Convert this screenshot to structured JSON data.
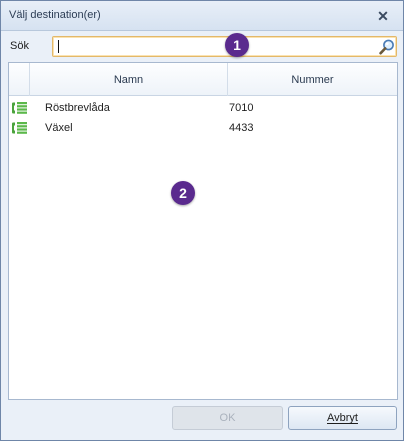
{
  "window": {
    "title": "Välj destination(er)",
    "close_glyph": "✕"
  },
  "search": {
    "label": "Sök",
    "value": "",
    "placeholder": ""
  },
  "grid": {
    "columns": [
      "Namn",
      "Nummer"
    ],
    "rows": [
      {
        "icon": "phone-list-icon",
        "name": "Röstbrevlåda",
        "number": "7010"
      },
      {
        "icon": "phone-list-icon",
        "name": "Växel",
        "number": "4433"
      }
    ]
  },
  "buttons": {
    "ok_label": "OK",
    "cancel_label": "Avbryt"
  },
  "callouts": [
    "1",
    "2"
  ],
  "colors": {
    "callout": "#5a2a8e",
    "search_border": "#e3b86a",
    "icon_green": "#4aa33c"
  }
}
